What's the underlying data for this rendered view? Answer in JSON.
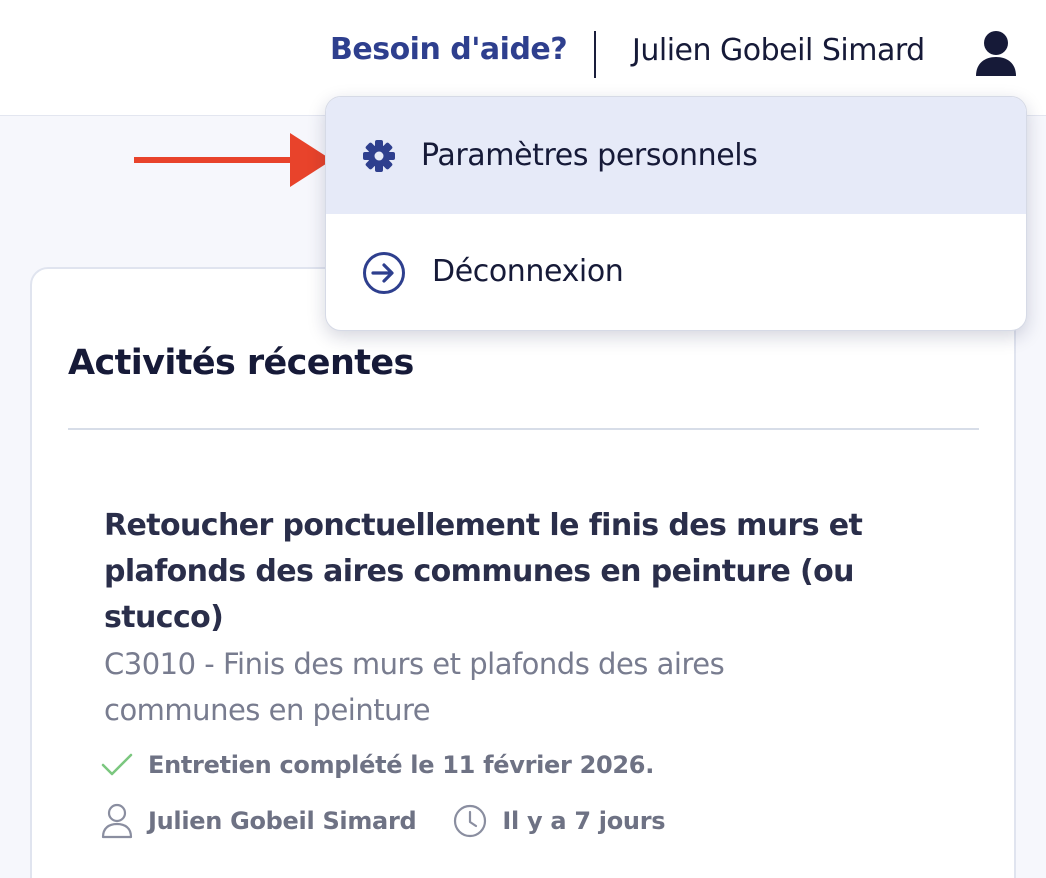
{
  "header": {
    "help_label": "Besoin d'aide?",
    "user_name": "Julien Gobeil Simard"
  },
  "user_menu": {
    "items": [
      {
        "label": "Paramètres personnels",
        "icon": "gear-icon",
        "active": true
      },
      {
        "label": "Déconnexion",
        "icon": "logout-arrow-icon",
        "active": false
      }
    ]
  },
  "recent_activity": {
    "title": "Activités récentes",
    "items": [
      {
        "title": "Retoucher ponctuellement le finis des murs et plafonds des aires communes en peinture (ou stucco)",
        "subtitle": "C3010 - Finis des murs et plafonds des aires communes en peinture",
        "status": "Entretien complété le 11 février 2026.",
        "author": "Julien Gobeil Simard",
        "time_ago": "Il y a 7 jours"
      }
    ]
  },
  "colors": {
    "brand_blue": "#2e3f8e",
    "text_dark": "#161a38",
    "annotation_arrow": "#e8432b",
    "success_check": "#7bc77f",
    "menu_active_bg": "#e6eaf8"
  }
}
